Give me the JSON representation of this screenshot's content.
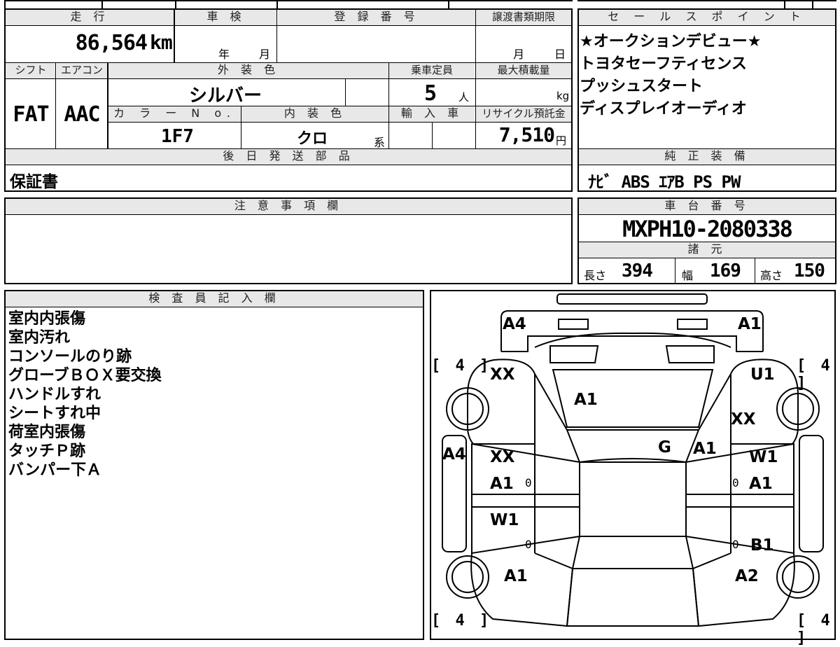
{
  "vehicle_info": {
    "mileage_label": "走 行",
    "mileage_value": "86,564",
    "mileage_unit": "km",
    "inspection_label": "車 検",
    "inspection_year_unit": "年",
    "inspection_month_unit": "月",
    "registration_label": "登 録 番 号",
    "transfer_deadline_label": "譲渡書類期限",
    "transfer_month_unit": "月",
    "transfer_day_unit": "日",
    "shift_label": "シフト",
    "shift_value": "FAT",
    "aircon_label": "エアコン",
    "aircon_value": "AAC",
    "exterior_color_label": "外 装 色",
    "exterior_color_value": "シルバー",
    "capacity_label": "乗車定員",
    "capacity_value": "5",
    "capacity_unit": "人",
    "max_load_label": "最大積載量",
    "max_load_unit": "kg",
    "color_no_label": "カ ラ ー N o.",
    "color_no_value": "1F7",
    "interior_color_label": "内 装 色",
    "interior_color_value": "クロ",
    "interior_color_suffix": "系",
    "import_label": "輸 入 車",
    "recycle_label": "リサイクル預託金",
    "recycle_value": "7,510",
    "recycle_unit": "円",
    "later_parts_label": "後 日 発 送 部 品",
    "later_parts_value": "保証書"
  },
  "sales_points": {
    "label": "セ ー ル ス ポ イ ン ト",
    "items": [
      "★オークションデビュー★",
      "トヨタセーフティセンス",
      "プッシュスタート",
      "ディスプレイオーディオ"
    ]
  },
  "genuine_equipment": {
    "label": "純 正 装 備",
    "value": "ﾅﾋﾞ ABS ｴｱB PS PW"
  },
  "caution": {
    "label": "注 意 事 項 欄"
  },
  "chassis": {
    "label": "車 台 番 号",
    "value": "MXPH10-2080338"
  },
  "specs": {
    "label": "諸 元",
    "length_label": "長さ",
    "length_value": "394",
    "width_label": "幅",
    "width_value": "169",
    "height_label": "高さ",
    "height_value": "150"
  },
  "inspector": {
    "label": "検 査 員 記 入 欄",
    "notes": [
      "室内内張傷",
      "室内汚れ",
      "コンソールのり跡",
      "グローブＢＯＸ要交換",
      "ハンドルすれ",
      "シートすれ中",
      "荷室内張傷",
      "タッチＰ跡",
      "バンパー下Ａ"
    ]
  },
  "damage_map": {
    "tire_tread": [
      "[ 4 ]",
      "[ 4 ]",
      "[ 4 ]",
      "[ 4 ]"
    ],
    "marks": {
      "front_left": "A4",
      "front_right": "A1",
      "hood": "A1",
      "fl_fender_upper": "XX",
      "fr_fender_upper": "U1",
      "fr_fender_lower": "XX",
      "roof_g": "G",
      "windshield_right": "A1",
      "left_side_outer": "A4",
      "fl_door_1": "XX",
      "fl_door_2": "A1",
      "fr_door_1": "W1",
      "fr_door_2": "A1",
      "rl_door": "W1",
      "rr_door": "B1",
      "rl_quarter": "A1",
      "rr_quarter": "A2"
    },
    "zero_marks": [
      "0",
      "0",
      "0",
      "0"
    ]
  }
}
